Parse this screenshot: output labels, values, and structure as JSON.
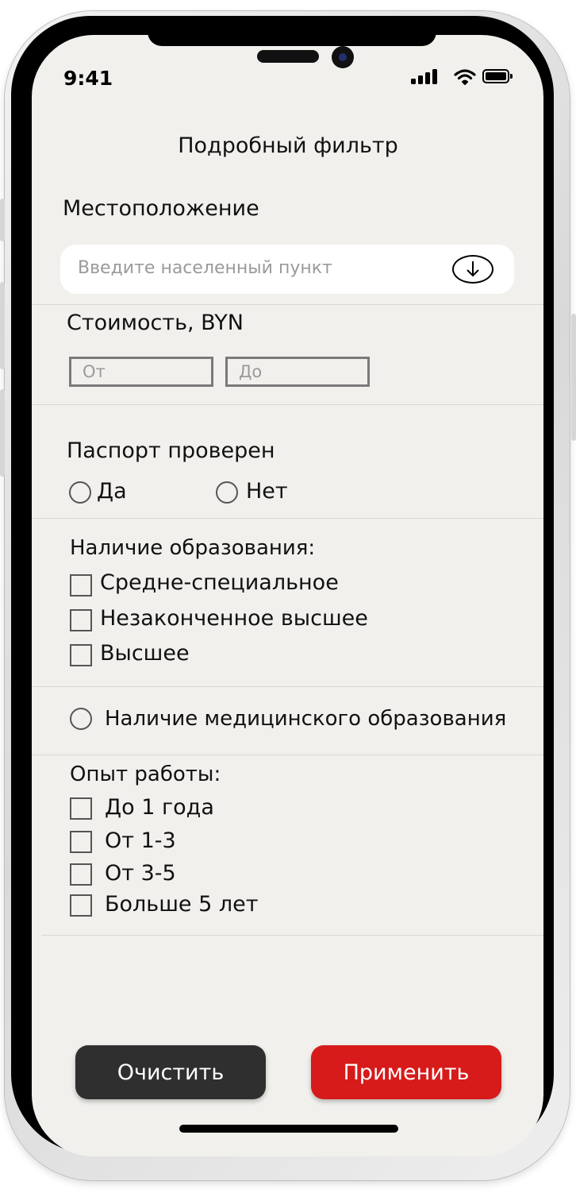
{
  "status_bar": {
    "time": "9:41"
  },
  "header": {
    "title": "Подробный фильтр"
  },
  "location": {
    "label": "Местоположение",
    "placeholder": "Введите населенный пункт"
  },
  "price": {
    "label": "Стоимость, BYN",
    "from_placeholder": "От",
    "to_placeholder": "До"
  },
  "passport": {
    "label": "Паспорт проверен",
    "options": [
      "Да",
      "Нет"
    ]
  },
  "education": {
    "label": "Наличие образования:",
    "options": [
      "Средне-специальное",
      "Незаконченное высшее",
      "Высшее"
    ]
  },
  "medical": {
    "label": "Наличие медицинского образования"
  },
  "experience": {
    "label": "Опыт работы:",
    "options": [
      "До 1 года",
      "От 1-3",
      "От 3-5",
      "Больше 5 лет"
    ]
  },
  "actions": {
    "clear_label": "Очистить",
    "apply_label": "Применить"
  },
  "colors": {
    "screen_background": "#f1f0ed",
    "clear_button": "#2f2f2f",
    "apply_button": "#d71a1a"
  }
}
